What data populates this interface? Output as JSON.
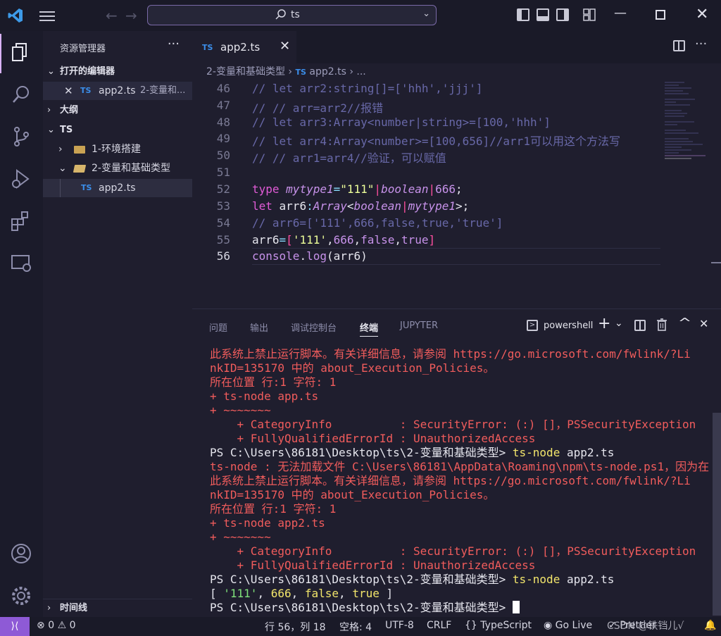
{
  "search": {
    "query": "ts"
  },
  "explorer": {
    "title": "资源管理器",
    "open_editors_label": "打开的编辑器",
    "open_editor": {
      "badge": "TS",
      "name": "app2.ts",
      "path": "2-变量和..."
    },
    "outline_label": "大纲",
    "folder_label": "TS",
    "folder_items": [
      "1-环境搭建",
      "2-变量和基础类型"
    ],
    "file": {
      "badge": "TS",
      "name": "app2.ts"
    },
    "timeline_label": "时间线"
  },
  "editor": {
    "tab": {
      "badge": "TS",
      "name": "app2.ts"
    },
    "breadcrumb": {
      "folder": "2-变量和基础类型",
      "badge": "TS",
      "file": "app2.ts",
      "more": "..."
    },
    "lines": [
      {
        "n": "46",
        "text": "// let arr2:string[]=['hhh','jjj']"
      },
      {
        "n": "47",
        "text": "// // arr=arr2//报错"
      },
      {
        "n": "48",
        "text": "// let arr3:Array<number|string>=[100,'hhh']"
      },
      {
        "n": "49",
        "text": "// let arr4:Array<number>=[100,656]//arr1可以用这个方法写"
      },
      {
        "n": "50",
        "text": "// // arr1=arr4//验证，可以赋值"
      },
      {
        "n": "51",
        "text": ""
      },
      {
        "n": "52",
        "text": "type mytype1=\"111\"|boolean|666;"
      },
      {
        "n": "53",
        "text": "let arr6:Array<boolean|mytype1>;"
      },
      {
        "n": "54",
        "text": "// arr6=['111',666,false,true,'true']"
      },
      {
        "n": "55",
        "text": "arr6=['111',666,false,true]"
      },
      {
        "n": "56",
        "text": "console.log(arr6)"
      }
    ]
  },
  "panel": {
    "tabs": [
      "问题",
      "输出",
      "调试控制台",
      "终端",
      "JUPYTER"
    ],
    "active_tab": "终端",
    "shell": "powershell",
    "terminal": [
      {
        "c": "r",
        "t": "此系统上禁止运行脚本。有关详细信息，请参阅 https://go.microsoft.com/fwlink/?Li"
      },
      {
        "c": "r",
        "t": "nkID=135170 中的 about_Execution_Policies。"
      },
      {
        "c": "r",
        "t": "所在位置 行:1 字符: 1"
      },
      {
        "c": "r",
        "t": "+ ts-node app.ts"
      },
      {
        "c": "r",
        "t": "+ ~~~~~~~"
      },
      {
        "c": "r",
        "t": "    + CategoryInfo          : SecurityError: (:) []，PSSecurityException"
      },
      {
        "c": "r",
        "t": "    + FullyQualifiedErrorId : UnauthorizedAccess"
      },
      {
        "c": "w",
        "t": "PS C:\\Users\\86181\\Desktop\\ts\\2-变量和基础类型> ",
        "y": "ts-node",
        "t2": " app2.ts"
      },
      {
        "c": "r",
        "t": "ts-node : 无法加载文件 C:\\Users\\86181\\AppData\\Roaming\\npm\\ts-node.ps1，因为在"
      },
      {
        "c": "r",
        "t": "此系统上禁止运行脚本。有关详细信息，请参阅 https://go.microsoft.com/fwlink/?Li"
      },
      {
        "c": "r",
        "t": "nkID=135170 中的 about_Execution_Policies。"
      },
      {
        "c": "r",
        "t": "所在位置 行:1 字符: 1"
      },
      {
        "c": "r",
        "t": "+ ts-node app2.ts"
      },
      {
        "c": "r",
        "t": "+ ~~~~~~~"
      },
      {
        "c": "r",
        "t": "    + CategoryInfo          : SecurityError: (:) []，PSSecurityException"
      },
      {
        "c": "r",
        "t": "    + FullyQualifiedErrorId : UnauthorizedAccess"
      },
      {
        "c": "w",
        "t": "PS C:\\Users\\86181\\Desktop\\ts\\2-变量和基础类型> ",
        "y": "ts-node",
        "t2": " app2.ts"
      },
      {
        "c": "out",
        "t": "[ '111', 666, false, true ]"
      },
      {
        "c": "w",
        "t": "PS C:\\Users\\86181\\Desktop\\ts\\2-变量和基础类型> ",
        "cursor": true
      }
    ]
  },
  "status": {
    "errors": "0",
    "warnings": "0",
    "position": "行 56，列 18",
    "spaces": "空格: 4",
    "encoding": "UTF-8",
    "eol": "CRLF",
    "language": "TypeScript",
    "golive": "Go Live",
    "prettier": "Prettier",
    "watermark": "CSDN @铁铛儿√"
  },
  "colors": {
    "accent": "#8e5ad6",
    "error": "#f15c5c",
    "ts_blue": "#3b8eea"
  }
}
